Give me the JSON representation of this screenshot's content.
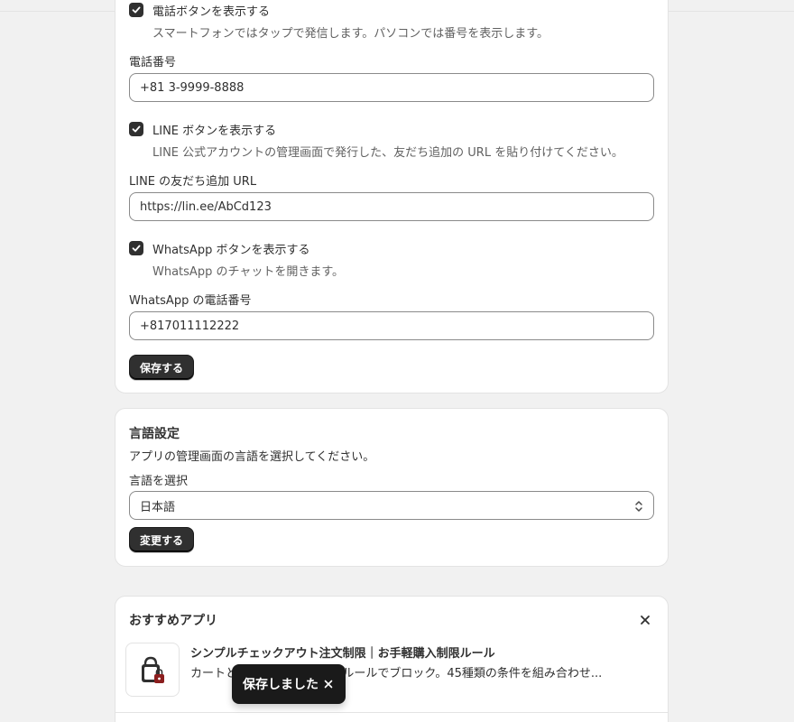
{
  "contact_settings": {
    "phone_toggle": {
      "label": "電話ボタンを表示する",
      "help": "スマートフォンではタップで発信します。パソコンでは番号を表示します。",
      "checked": true
    },
    "phone_field": {
      "label": "電話番号",
      "value": "+81 3-9999-8888"
    },
    "line_toggle": {
      "label": "LINE ボタンを表示する",
      "help": "LINE 公式アカウントの管理画面で発行した、友だち追加の URL を貼り付けてください。",
      "checked": true
    },
    "line_field": {
      "label": "LINE の友だち追加 URL",
      "value": "https://lin.ee/AbCd123"
    },
    "whatsapp_toggle": {
      "label": "WhatsApp ボタンを表示する",
      "help": "WhatsApp のチャットを開きます。",
      "checked": true
    },
    "whatsapp_field": {
      "label": "WhatsApp の電話番号",
      "value": "+817011112222"
    },
    "save_label": "保存する"
  },
  "language_settings": {
    "title": "言語設定",
    "description": "アプリの管理画面の言語を選択してください。",
    "select_label": "言語を選択",
    "selected": "日本語",
    "change_label": "変更する"
  },
  "recommended": {
    "title": "おすすめアプリ",
    "app_title": "シンプルチェックアウト注文制限｜お手軽購入制限ルール",
    "app_desc": "カートと...要な注文を柔軟なルールでブロック。45種類の条件を組み合わせ..."
  },
  "toast": {
    "message": "保存しました"
  },
  "colors": {
    "primary": "#303030",
    "background": "#f1f1f1",
    "toast": "#1a1a1a"
  }
}
